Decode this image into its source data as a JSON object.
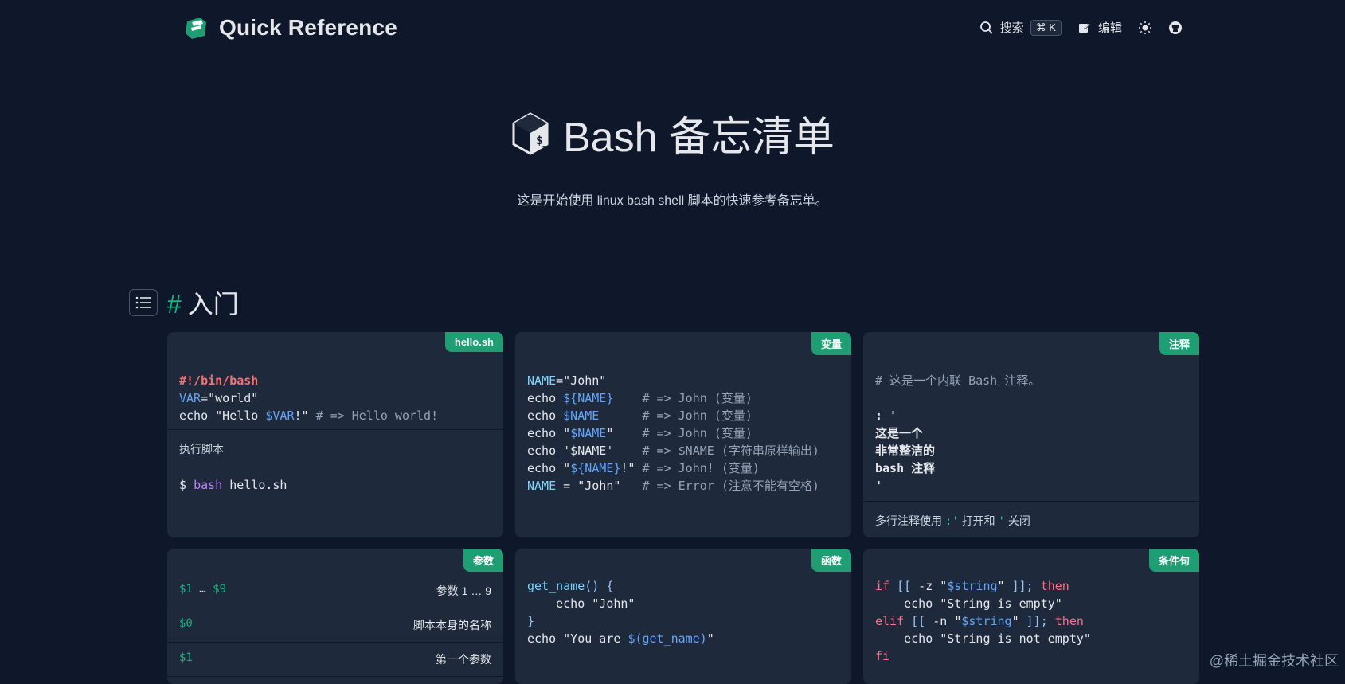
{
  "header": {
    "brand": "Quick Reference",
    "search_label": "搜索",
    "shortcut": "⌘ K",
    "edit_label": "编辑"
  },
  "hero": {
    "title": "Bash 备忘清单",
    "description": "这是开始使用 linux bash shell 脚本的快速参考备忘单。"
  },
  "section": {
    "hash": "#",
    "title": "入门"
  },
  "cards": {
    "hello": {
      "tag": "hello.sh",
      "note_label": "执行脚本"
    },
    "vars": {
      "tag": "变量"
    },
    "comments": {
      "tag": "注释",
      "note_prefix": "多行注释使用",
      "note_open": ":'",
      "note_mid": "打开和",
      "note_close": "'",
      "note_suffix": "关闭"
    },
    "params": {
      "tag": "参数",
      "rows": [
        {
          "key_a": "$1",
          "key_mid": " … ",
          "key_b": "$9",
          "value": "参数 1 … 9"
        },
        {
          "key": "$0",
          "value": "脚本本身的名称"
        },
        {
          "key": "$1",
          "value": "第一个参数"
        }
      ]
    },
    "funcs": {
      "tag": "函数"
    },
    "cond": {
      "tag": "条件句"
    }
  },
  "watermark": "@稀土掘金技术社区",
  "colors": {
    "background": "#0f172a",
    "card": "#1e293b",
    "accent": "#1f9e73"
  }
}
